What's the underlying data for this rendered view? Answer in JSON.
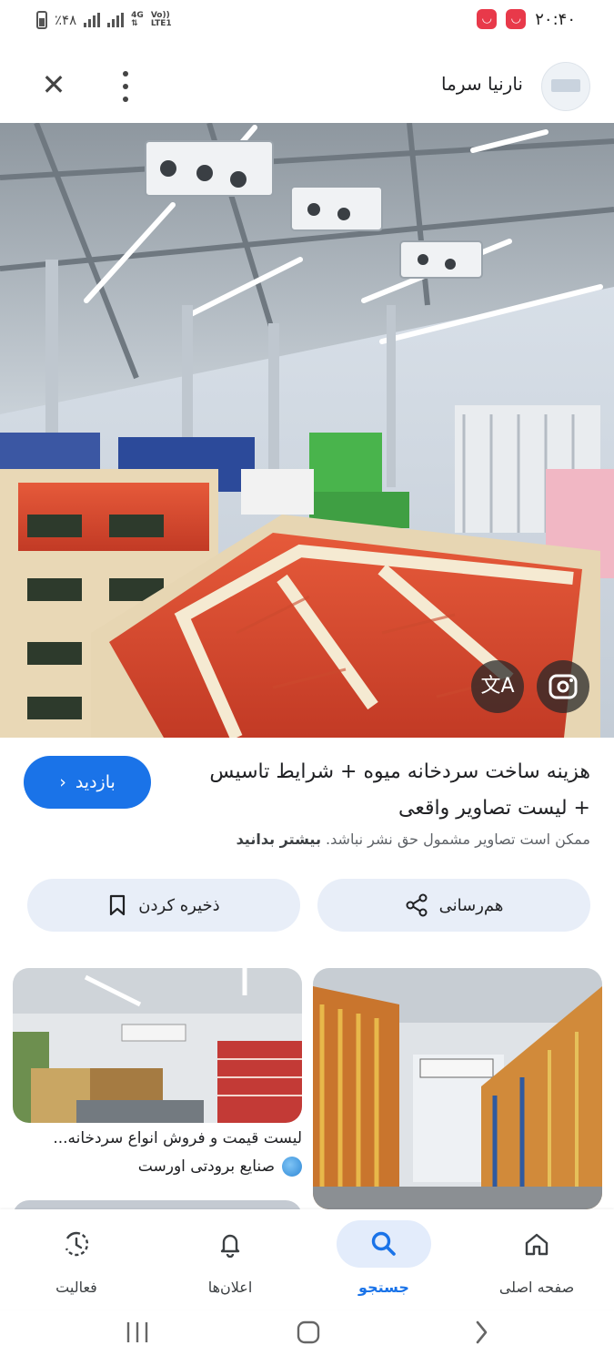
{
  "status_bar": {
    "battery": "٪۴۸",
    "network": "4G",
    "volte": "Vo))",
    "lte": "LTE1",
    "time": "۲۰:۴۰"
  },
  "header": {
    "site_name": "نارنیا سرما",
    "logo_icon": "site-logo-icon",
    "close_icon": "close-icon",
    "more_icon": "more-vert-icon"
  },
  "hero": {
    "translate_icon": "translate-icon",
    "lens_icon": "lens-icon"
  },
  "result": {
    "title": "هزینه ساخت سردخانه میوه + شرایط تاسیس + لیست تصاویر واقعی",
    "visit_label": "بازدید",
    "copyright_text": "ممکن است تصاویر مشمول حق نشر نباشد.",
    "learn_more": "بیشتر بدانید"
  },
  "actions": {
    "share_label": "هم‌رسانی",
    "save_label": "ذخیره کردن"
  },
  "related": {
    "title": "لیست قیمت و فروش انواع سردخانه...",
    "source": "صنایع برودتی اورست"
  },
  "bottom_nav": {
    "home": "صفحه اصلی",
    "search": "جستجو",
    "notifications": "اعلان‌ها",
    "activity": "فعالیت",
    "active": "search"
  },
  "colors": {
    "accent": "#1a73e8",
    "pill_bg": "#e8eef8",
    "notif_red": "#e8394a"
  }
}
